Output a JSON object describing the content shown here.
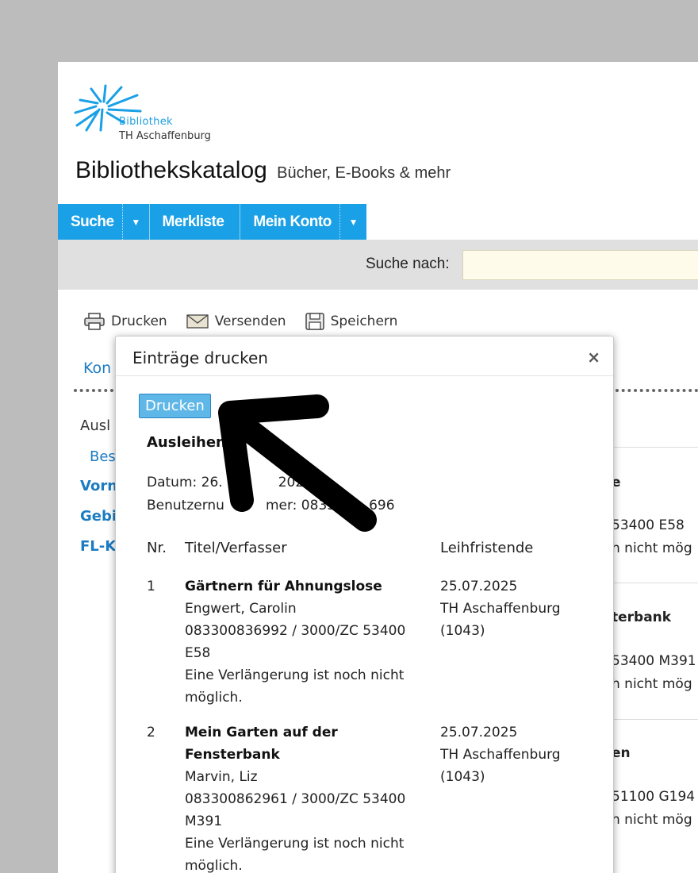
{
  "logo": {
    "line1": "Bibliothek",
    "line2": "TH Aschaffenburg"
  },
  "header": {
    "title": "Bibliothekskatalog",
    "subtitle": "Bücher, E-Books & mehr"
  },
  "nav": {
    "items": [
      {
        "label": "Suche"
      },
      {
        "label": "Merkliste"
      },
      {
        "label": "Mein Konto"
      }
    ]
  },
  "search": {
    "label": "Suche nach:",
    "value": ""
  },
  "toolbar": {
    "print": "Drucken",
    "send": "Versenden",
    "save": "Speichern"
  },
  "background": {
    "konto": "Kon",
    "left_items": [
      "Ausl",
      "Bes",
      "Vorn",
      "Gebi",
      "FL-K"
    ],
    "right_items": [
      "e",
      "53400 E58",
      "h nicht mög",
      "terbank",
      "53400 M391",
      "h nicht mög",
      "en",
      "51100 G194",
      "h nicht mög"
    ]
  },
  "modal": {
    "title": "Einträge drucken",
    "close": "×",
    "print_button": "Drucken",
    "heading": "Ausleihen",
    "date_label": "Datum: 26.",
    "date_tail": "2025",
    "user_label": "Benutzernu",
    "user_middle": "mer: 0833",
    "user_tail": "696",
    "columns": {
      "nr": "Nr.",
      "title": "Titel/Verfasser",
      "due": "Leihfristende"
    },
    "rows": [
      {
        "nr": "1",
        "title": "Gärtnern für Ahnungslose",
        "author": "Engwert, Carolin",
        "signature1": "083300836992 / 3000/ZC 53400",
        "signature2": "E58",
        "note1": "Eine Verlängerung ist noch nicht",
        "note2": "möglich.",
        "due_date": "25.07.2025",
        "branch": "TH Aschaffenburg",
        "branch_code": "(1043)"
      },
      {
        "nr": "2",
        "title1": "Mein Garten auf der",
        "title2": "Fensterbank",
        "author": "Marvin, Liz",
        "signature1": "083300862961 / 3000/ZC 53400",
        "signature2": "M391",
        "note1": "Eine Verlängerung ist noch nicht",
        "note2": "möglich.",
        "due_date": "25.07.2025",
        "branch": "TH Aschaffenburg",
        "branch_code": "(1043)"
      }
    ]
  },
  "colors": {
    "nav_blue": "#1aa0e6",
    "button_blue": "#5fb7e8",
    "link_blue": "#1c7cc2",
    "page_bg": "#bcbcbc"
  }
}
